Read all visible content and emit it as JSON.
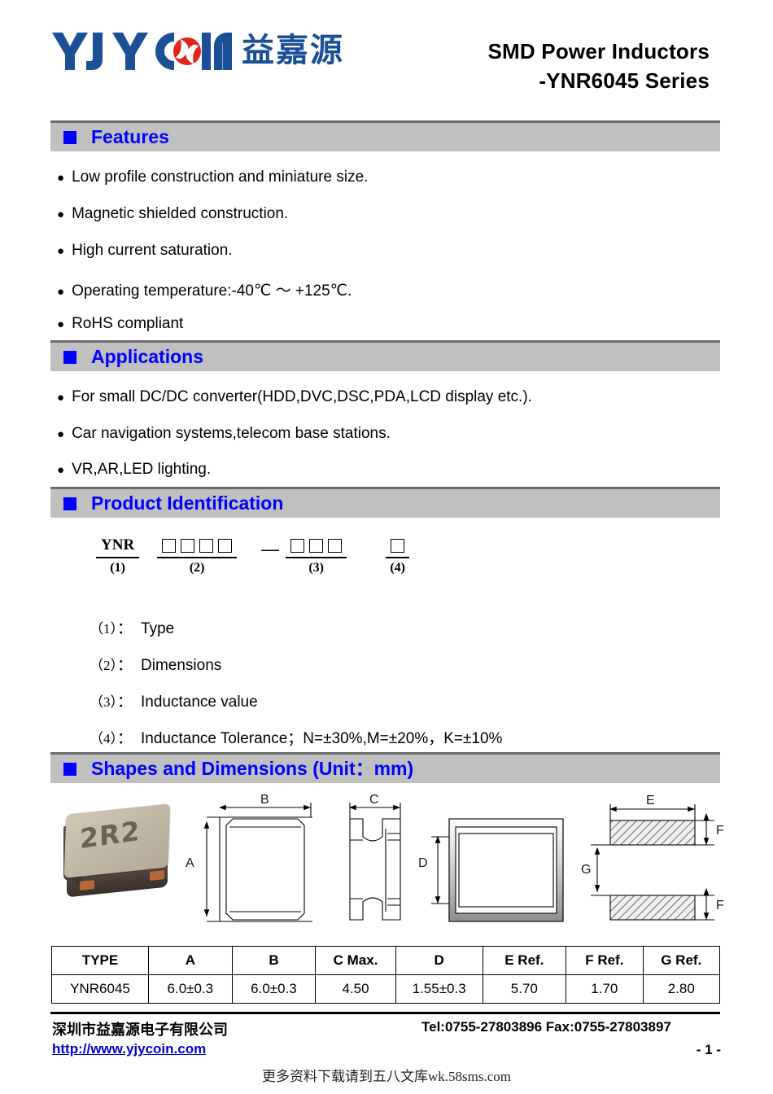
{
  "header": {
    "logo_text": "YJYCOIN",
    "logo_cn": "益嘉源",
    "title_line1": "SMD Power Inductors",
    "title_line2": "-YNR6045 Series"
  },
  "sections": {
    "features": {
      "title": "Features",
      "items": [
        "Low profile construction and miniature size.",
        "Magnetic shielded construction.",
        "High current saturation.",
        "Operating temperature:-40℃ ～ +125℃.",
        "RoHS compliant"
      ]
    },
    "applications": {
      "title": "Applications",
      "items": [
        "For small DC/DC converter(HDD,DVC,DSC,PDA,LCD display etc.).",
        "Car navigation systems,telecom base stations.",
        "VR,AR,LED lighting."
      ]
    },
    "product_identification": {
      "title": "Product Identification",
      "code": {
        "part1_text": "YNR",
        "part1_num": "(1)",
        "part2_boxes": 4,
        "part2_num": "(2)",
        "separator": "—",
        "part3_boxes": 3,
        "part3_num": "(3)",
        "part4_boxes": 1,
        "part4_num": "(4)"
      },
      "legend": [
        {
          "index": "（1）",
          "colon": "：",
          "text": "Type"
        },
        {
          "index": "（2）",
          "colon": "：",
          "text": "Dimensions"
        },
        {
          "index": "（3）",
          "colon": "：",
          "text": "Inductance value"
        },
        {
          "index": "（4）",
          "colon": "：",
          "text": "Inductance Tolerance；N=±30%,M=±20%，K=±10%"
        }
      ]
    },
    "shapes": {
      "title": "Shapes and Dimensions (Unit：mm)",
      "photo_marking": "2R2",
      "dim_labels": {
        "A": "A",
        "B": "B",
        "C": "C",
        "D": "D",
        "E": "E",
        "F1": "F",
        "F2": "F",
        "G": "G"
      }
    }
  },
  "spec_table": {
    "headers": [
      "TYPE",
      "A",
      "B",
      "C Max.",
      "D",
      "E Ref.",
      "F Ref.",
      "G Ref."
    ],
    "rows": [
      [
        "YNR6045",
        "6.0±0.3",
        "6.0±0.3",
        "4.50",
        "1.55±0.3",
        "5.70",
        "1.70",
        "2.80"
      ]
    ]
  },
  "footer": {
    "company": "深圳市益嘉源电子有限公司",
    "url": "http://www.yjycoin.com",
    "contact": "Tel:0755-27803896   Fax:0755-27803897",
    "page": "- 1 -",
    "watermark": "更多资料下载请到五八文库wk.58sms.com"
  },
  "colors": {
    "accent_blue": "#0000ff",
    "bar_gray": "#c0c0c0",
    "logo_blue": "#1b4f96",
    "logo_red": "#e2231a",
    "link_blue": "#0000cc"
  }
}
